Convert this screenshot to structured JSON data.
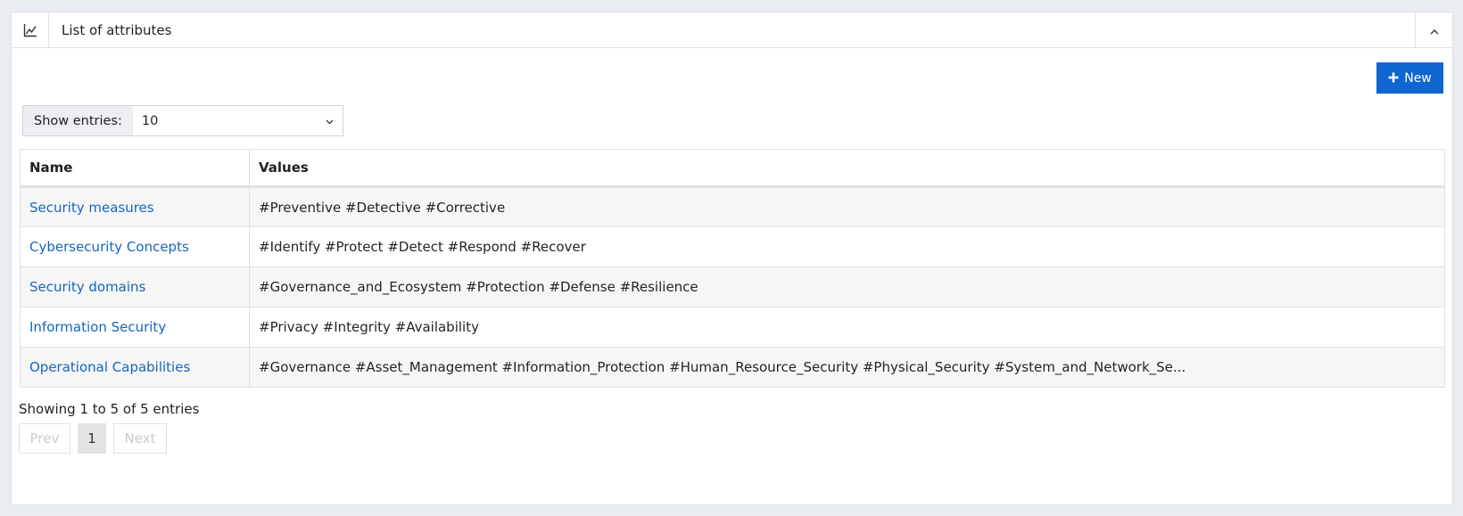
{
  "panel": {
    "title": "List of attributes",
    "header_icon": "chart-line-icon",
    "collapse_icon": "chevron-up-icon"
  },
  "toolbar": {
    "new_label": "New",
    "new_icon": "plus-icon"
  },
  "entries": {
    "label": "Show entries:",
    "value": "10"
  },
  "table": {
    "columns": [
      "Name",
      "Values"
    ],
    "rows": [
      {
        "name": "Security measures",
        "values": "#Preventive #Detective #Corrective"
      },
      {
        "name": "Cybersecurity Concepts",
        "values": "#Identify #Protect #Detect #Respond #Recover"
      },
      {
        "name": "Security domains",
        "values": "#Governance_and_Ecosystem #Protection #Defense #Resilience"
      },
      {
        "name": "Information Security",
        "values": "#Privacy #Integrity #Availability"
      },
      {
        "name": "Operational Capabilities",
        "values": "#Governance #Asset_Management #Information_Protection #Human_Resource_Security #Physical_Security #System_and_Network_Se..."
      }
    ]
  },
  "footer": {
    "info": "Showing 1 to 5 of 5 entries",
    "prev": "Prev",
    "current_page": "1",
    "next": "Next"
  },
  "colors": {
    "accent": "#0f66d0",
    "link": "#1565c0"
  }
}
